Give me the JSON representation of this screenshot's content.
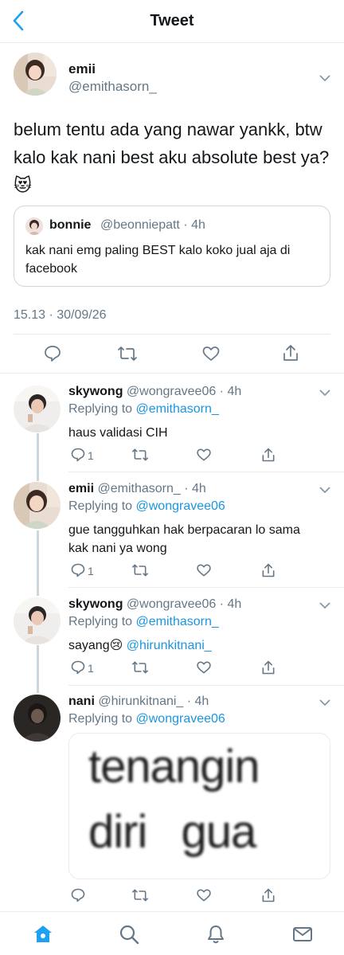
{
  "header": {
    "title": "Tweet"
  },
  "main_tweet": {
    "name": "emii",
    "handle": "@emithasorn_",
    "text": "belum tentu ada yang nawar yankk, btw kalo kak nani best aku absolute best ya?",
    "emoji": "😻",
    "timestamp": "15.13 · 30/09/26",
    "quote": {
      "name": "bonnie",
      "handle": "@beonniepatt",
      "time": "· 4h",
      "text": "kak nani emg paling BEST kalo koko jual aja di facebook"
    }
  },
  "replies": [
    {
      "name": "skywong",
      "handle": "@wongravee06 · 4h",
      "replying_label": "Replying to",
      "replying_to": "@emithasorn_",
      "text": "haus validasi CIH",
      "reply_count": "1"
    },
    {
      "name": "emii",
      "handle": "@emithasorn_ · 4h",
      "replying_label": "Replying to",
      "replying_to": "@wongravee06",
      "text": "gue tangguhkan hak berpacaran lo sama kak nani ya wong",
      "reply_count": "1"
    },
    {
      "name": "skywong",
      "handle": "@wongravee06 · 4h",
      "replying_label": "Replying to",
      "replying_to": "@emithasorn_",
      "text": "sayang",
      "emoji": "😢",
      "mention": "@hirunkitnani_",
      "reply_count": "1"
    },
    {
      "name": "nani",
      "handle": "@hirunkitnani_ · 4h",
      "replying_label": "Replying to",
      "replying_to": "@wongravee06",
      "media_line1": "tenangin",
      "media_line2": "diri gua",
      "reply_count": ""
    }
  ],
  "tabbar": {
    "icons": [
      "home-icon",
      "search-icon",
      "notifications-icon",
      "messages-icon"
    ]
  },
  "colors": {
    "accent": "#1da1f2",
    "mention": "#1b95e0",
    "muted": "#657786",
    "divider": "#e6ecf0"
  }
}
